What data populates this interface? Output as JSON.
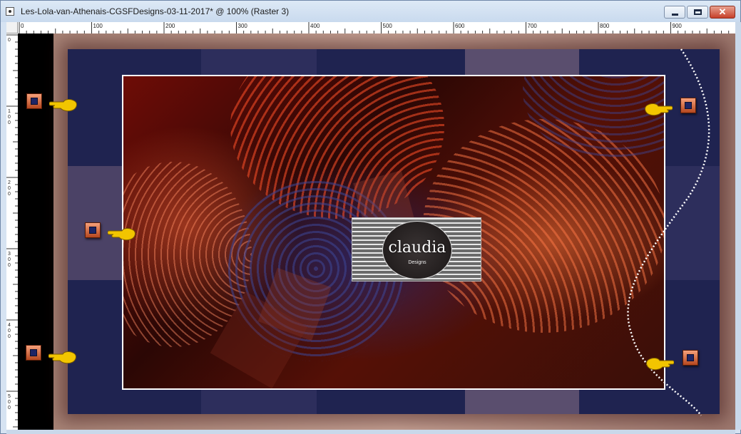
{
  "window": {
    "title": "Les-Lola-van-Athenais-CGSFDesigns-03-11-2017* @ 100% (Raster 3)",
    "controls": {
      "minimize": "minimize",
      "maximize": "maximize",
      "close": "✕"
    }
  },
  "ruler": {
    "top_labels": [
      "0",
      "100",
      "200",
      "300",
      "400",
      "500",
      "600",
      "700",
      "800",
      "900"
    ],
    "left_labels": [
      "0",
      "100",
      "200",
      "300",
      "400",
      "500"
    ]
  },
  "watermark": {
    "logo_text": "claudia",
    "logo_subtext": "Designs"
  },
  "colors": {
    "navy": "#1f2350",
    "frame": "#b8968a",
    "handle": "#e0703f",
    "pointer": "#f2c500"
  },
  "icons": {
    "handle": "square-handle-icon",
    "pointer": "pointing-hand-icon"
  }
}
